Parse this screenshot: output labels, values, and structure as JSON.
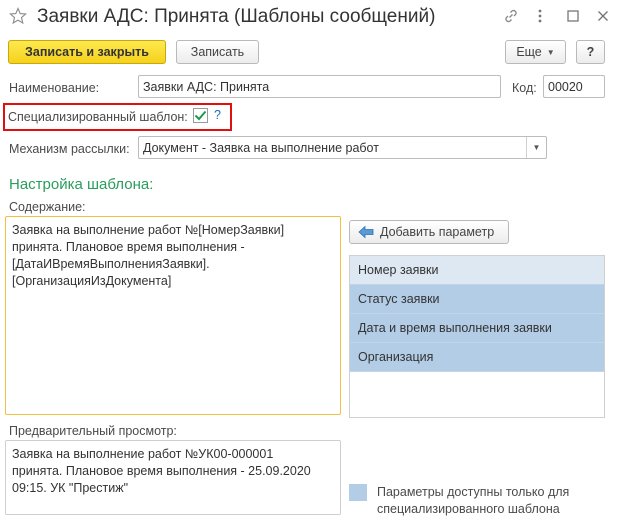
{
  "window": {
    "title": "Заявки АДС: Принята (Шаблоны сообщений)"
  },
  "toolbar": {
    "save_close_label": "Записать и закрыть",
    "save_label": "Записать",
    "more_label": "Еще",
    "help_label": "?"
  },
  "fields": {
    "name_label": "Наименование:",
    "name_value": "Заявки АДС: Принята",
    "code_label": "Код:",
    "code_value": "00020",
    "specialized_label": "Специализированный шаблон:",
    "specialized_checked": true,
    "specialized_help": "?",
    "mechanism_label": "Механизм рассылки:",
    "mechanism_value": "Документ - Заявка на выполнение работ"
  },
  "template": {
    "section_title": "Настройка шаблона:",
    "content_label": "Содержание:",
    "content_text": "Заявка на выполнение работ №[НомерЗаявки]\nпринята. Плановое время выполнения -\n[ДатаИВремяВыполненияЗаявки].\n[ОрганизацияИзДокумента]",
    "add_param_label": "Добавить параметр",
    "params": [
      "Номер заявки",
      "Статус заявки",
      "Дата и время выполнения заявки",
      "Организация"
    ],
    "preview_label": "Предварительный просмотр:",
    "preview_text": "Заявка на выполнение работ №УК00-000001\nпринята. Плановое время выполнения - 25.09.2020\n09:15. УК \"Престиж\"",
    "legend_text": "Параметры доступны только для\nспециализированного шаблона"
  },
  "colors": {
    "accent_green": "#2a9d5c",
    "primary_yellow": "#f6d11c",
    "param_blue": "#b3cde6",
    "highlight_red": "#e01010"
  }
}
